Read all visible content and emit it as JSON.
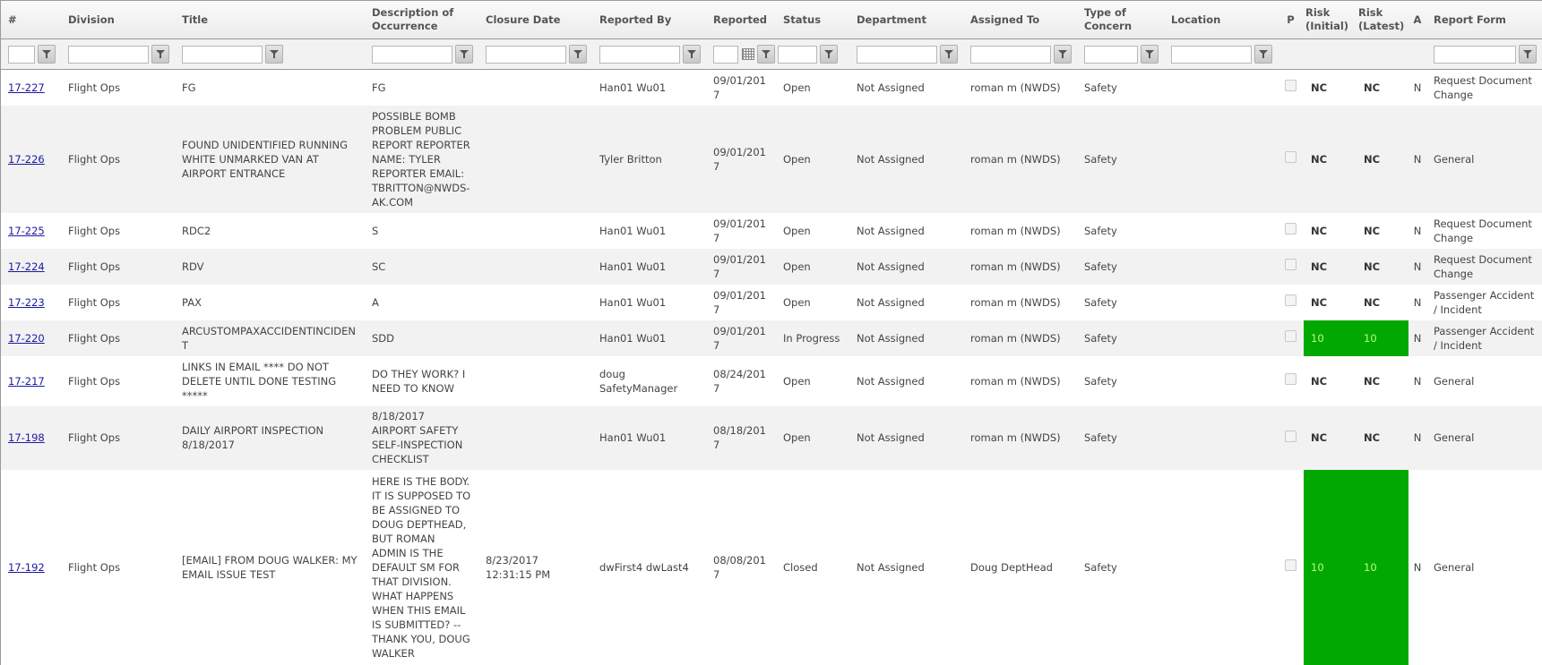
{
  "columns": [
    {
      "key": "id",
      "label": "#",
      "filter": "text"
    },
    {
      "key": "division",
      "label": "Division",
      "filter": "text"
    },
    {
      "key": "title",
      "label": "Title",
      "filter": "text"
    },
    {
      "key": "description",
      "label": "Description of Occurrence",
      "filter": "text"
    },
    {
      "key": "closure_date",
      "label": "Closure Date",
      "filter": "text"
    },
    {
      "key": "reported_by",
      "label": "Reported By",
      "filter": "text"
    },
    {
      "key": "reported",
      "label": "Reported",
      "filter": "date"
    },
    {
      "key": "status",
      "label": "Status",
      "filter": "text"
    },
    {
      "key": "department",
      "label": "Department",
      "filter": "text"
    },
    {
      "key": "assigned_to",
      "label": "Assigned To",
      "filter": "text"
    },
    {
      "key": "type_of_concern",
      "label": "Type of Concern",
      "filter": "text"
    },
    {
      "key": "location",
      "label": "Location",
      "filter": "text"
    },
    {
      "key": "p",
      "label": "P",
      "filter": "none"
    },
    {
      "key": "risk_initial",
      "label": "Risk (Initial)",
      "filter": "none"
    },
    {
      "key": "risk_latest",
      "label": "Risk (Latest)",
      "filter": "none"
    },
    {
      "key": "a",
      "label": "A",
      "filter": "none"
    },
    {
      "key": "report_form",
      "label": "Report Form",
      "filter": "text"
    }
  ],
  "filters": {
    "id": "",
    "division": "",
    "title": "",
    "description": "",
    "closure_date": "",
    "reported_by": "",
    "reported": "",
    "status": "",
    "department": "",
    "assigned_to": "",
    "type_of_concern": "",
    "location": "",
    "report_form": ""
  },
  "icons": {
    "filter": "funnel-icon",
    "calendar": "calendar-icon"
  },
  "colors": {
    "risk_green": "#00a800",
    "risk_green_text": "#b8ff7a",
    "link": "#1a1aa0",
    "row_alt": "#f2f2f2"
  },
  "rows": [
    {
      "id": "17-227",
      "division": "Flight Ops",
      "title": "FG",
      "description": "FG",
      "closure_date": "",
      "reported_by": "Han01 Wu01",
      "reported": "09/01/2017",
      "status": "Open",
      "department": "Not Assigned",
      "assigned_to": "roman m (NWDS)",
      "type_of_concern": "Safety",
      "location": "",
      "p": false,
      "risk_initial": "NC",
      "risk_latest": "NC",
      "risk_color": "",
      "a": "N",
      "report_form": "Request Document Change"
    },
    {
      "id": "17-226",
      "division": "Flight Ops",
      "title": "FOUND UNIDENTIFIED RUNNING WHITE UNMARKED VAN AT AIRPORT ENTRANCE",
      "description": "POSSIBLE BOMB PROBLEM PUBLIC REPORT REPORTER NAME: TYLER REPORTER EMAIL: TBRITTON@NWDS-AK.COM",
      "closure_date": "",
      "reported_by": "Tyler Britton",
      "reported": "09/01/2017",
      "status": "Open",
      "department": "Not Assigned",
      "assigned_to": "roman m (NWDS)",
      "type_of_concern": "Safety",
      "location": "",
      "p": false,
      "risk_initial": "NC",
      "risk_latest": "NC",
      "risk_color": "",
      "a": "N",
      "report_form": "General"
    },
    {
      "id": "17-225",
      "division": "Flight Ops",
      "title": "RDC2",
      "description": "S",
      "closure_date": "",
      "reported_by": "Han01 Wu01",
      "reported": "09/01/2017",
      "status": "Open",
      "department": "Not Assigned",
      "assigned_to": "roman m (NWDS)",
      "type_of_concern": "Safety",
      "location": "",
      "p": false,
      "risk_initial": "NC",
      "risk_latest": "NC",
      "risk_color": "",
      "a": "N",
      "report_form": "Request Document Change"
    },
    {
      "id": "17-224",
      "division": "Flight Ops",
      "title": "RDV",
      "description": "SC",
      "closure_date": "",
      "reported_by": "Han01 Wu01",
      "reported": "09/01/2017",
      "status": "Open",
      "department": "Not Assigned",
      "assigned_to": "roman m (NWDS)",
      "type_of_concern": "Safety",
      "location": "",
      "p": false,
      "risk_initial": "NC",
      "risk_latest": "NC",
      "risk_color": "",
      "a": "N",
      "report_form": "Request Document Change"
    },
    {
      "id": "17-223",
      "division": "Flight Ops",
      "title": "PAX",
      "description": "A",
      "closure_date": "",
      "reported_by": "Han01 Wu01",
      "reported": "09/01/2017",
      "status": "Open",
      "department": "Not Assigned",
      "assigned_to": "roman m (NWDS)",
      "type_of_concern": "Safety",
      "location": "",
      "p": false,
      "risk_initial": "NC",
      "risk_latest": "NC",
      "risk_color": "",
      "a": "N",
      "report_form": "Passenger Accident / Incident"
    },
    {
      "id": "17-220",
      "division": "Flight Ops",
      "title": "ARCUSTOMPAXACCIDENTINCIDENT",
      "description": "SDD",
      "closure_date": "",
      "reported_by": "Han01 Wu01",
      "reported": "09/01/2017",
      "status": "In Progress",
      "department": "Not Assigned",
      "assigned_to": "roman m (NWDS)",
      "type_of_concern": "Safety",
      "location": "",
      "p": false,
      "risk_initial": "10",
      "risk_latest": "10",
      "risk_color": "green",
      "a": "N",
      "report_form": "Passenger Accident / Incident"
    },
    {
      "id": "17-217",
      "division": "Flight Ops",
      "title": "LINKS IN EMAIL **** DO NOT DELETE UNTIL DONE TESTING *****",
      "description": "DO THEY WORK? I NEED TO KNOW",
      "closure_date": "",
      "reported_by": "doug SafetyManager",
      "reported": "08/24/2017",
      "status": "Open",
      "department": "Not Assigned",
      "assigned_to": "roman m (NWDS)",
      "type_of_concern": "Safety",
      "location": "",
      "p": false,
      "risk_initial": "NC",
      "risk_latest": "NC",
      "risk_color": "",
      "a": "N",
      "report_form": "General"
    },
    {
      "id": "17-198",
      "division": "Flight Ops",
      "title": "DAILY AIRPORT INSPECTION 8/18/2017",
      "description": "8/18/2017 AIRPORT SAFETY SELF-INSPECTION CHECKLIST",
      "closure_date": "",
      "reported_by": "Han01 Wu01",
      "reported": "08/18/2017",
      "status": "Open",
      "department": "Not Assigned",
      "assigned_to": "roman m (NWDS)",
      "type_of_concern": "Safety",
      "location": "",
      "p": false,
      "risk_initial": "NC",
      "risk_latest": "NC",
      "risk_color": "",
      "a": "N",
      "report_form": "General"
    },
    {
      "id": "17-192",
      "division": "Flight Ops",
      "title": "[EMAIL] FROM DOUG WALKER: MY EMAIL ISSUE TEST",
      "description": "HERE IS THE BODY. IT IS SUPPOSED TO BE ASSIGNED TO DOUG DEPTHEAD, BUT ROMAN ADMIN IS THE DEFAULT SM FOR THAT DIVISION. WHAT HAPPENS WHEN THIS EMAIL IS SUBMITTED? -- THANK YOU, DOUG WALKER",
      "closure_date": "8/23/2017 12:31:15 PM",
      "reported_by": "dwFirst4 dwLast4",
      "reported": "08/08/2017",
      "status": "Closed",
      "department": "Not Assigned",
      "assigned_to": "Doug DeptHead",
      "type_of_concern": "Safety",
      "location": "",
      "p": false,
      "risk_initial": "10",
      "risk_latest": "10",
      "risk_color": "green",
      "a": "N",
      "report_form": "General"
    }
  ]
}
